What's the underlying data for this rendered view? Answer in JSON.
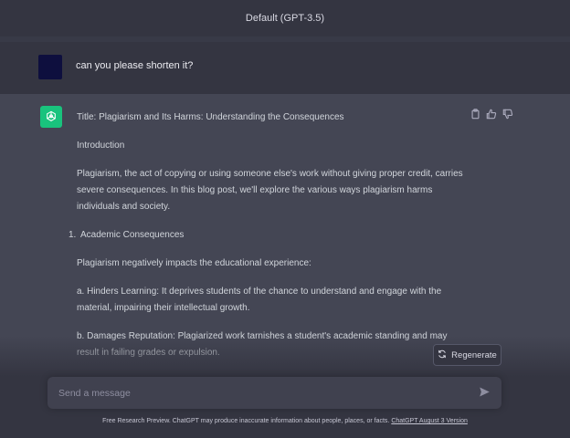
{
  "header": {
    "model_label": "Default (GPT-3.5)"
  },
  "user_message": {
    "text": "can you please shorten it?"
  },
  "assistant_message": {
    "title": "Title: Plagiarism and Its Harms: Understanding the Consequences",
    "intro_heading": "Introduction",
    "intro_text": "Plagiarism, the act of copying or using someone else's work without giving proper credit, carries severe consequences. In this blog post, we'll explore the various ways plagiarism harms individuals and society.",
    "list_number": "1.",
    "list_item": "Academic Consequences",
    "academic_text": "Plagiarism negatively impacts the educational experience:",
    "point_a": "a. Hinders Learning: It deprives students of the chance to understand and engage with the material, impairing their intellectual growth.",
    "point_b": "b. Damages Reputation: Plagiarized work tarnishes a student's academic standing and may result in failing grades or expulsion."
  },
  "actions": {
    "icons": [
      "clipboard-icon",
      "thumbs-up-icon",
      "thumbs-down-icon"
    ]
  },
  "regenerate": {
    "label": "Regenerate"
  },
  "composer": {
    "placeholder": "Send a message"
  },
  "footer": {
    "text": "Free Research Preview. ChatGPT may produce inaccurate information about people, places, or facts.",
    "link": "ChatGPT August 3 Version"
  },
  "colors": {
    "brand": "#19c37d",
    "background": "#444654",
    "header": "#343541"
  }
}
